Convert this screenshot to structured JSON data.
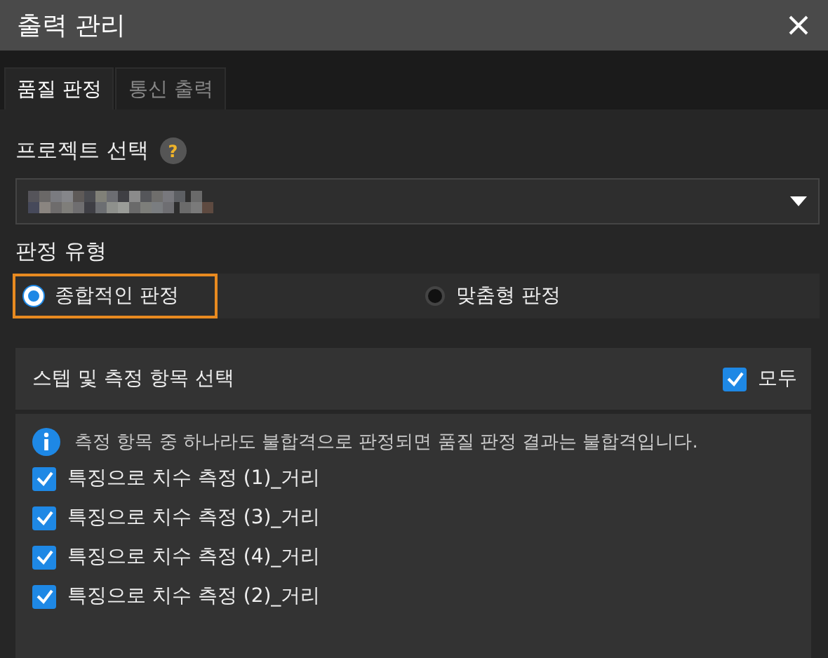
{
  "window": {
    "title": "출력 관리"
  },
  "tabs": [
    {
      "label": "품질 판정",
      "selected": true
    },
    {
      "label": "통신 출력",
      "selected": false
    }
  ],
  "project": {
    "label": "프로젝트 선택",
    "help": "?"
  },
  "judgement": {
    "label": "판정 유형",
    "options": [
      {
        "label": "종합적인 판정",
        "selected": true
      },
      {
        "label": "맞춤형 판정",
        "selected": false
      }
    ]
  },
  "steps": {
    "title": "스텝 및 측정 항목 선택",
    "all": {
      "label": "모두",
      "checked": true
    },
    "info": "측정 항목 중 하나라도 불합격으로 판정되면 품질 판정 결과는 불합격입니다.",
    "items": [
      {
        "label": "특징으로 치수 측정 (1)_거리",
        "checked": true
      },
      {
        "label": "특징으로 치수 측정 (3)_거리",
        "checked": true
      },
      {
        "label": "특징으로 치수 측정 (4)_거리",
        "checked": true
      },
      {
        "label": "특징으로 치수 측정 (2)_거리",
        "checked": true
      }
    ]
  }
}
